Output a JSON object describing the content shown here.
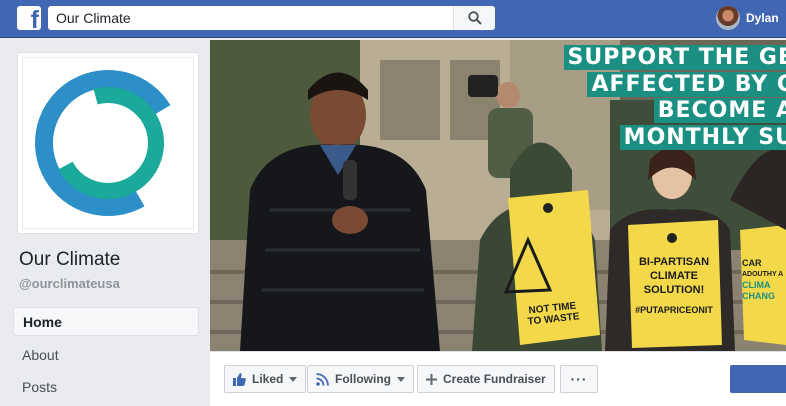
{
  "topbar": {
    "logo_letter": "f",
    "search_value": "Our Climate",
    "user_name": "Dylan"
  },
  "page": {
    "name": "Our Climate",
    "handle": "@ourclimateusa"
  },
  "nav": [
    {
      "label": "Home",
      "active": true
    },
    {
      "label": "About",
      "active": false
    },
    {
      "label": "Posts",
      "active": false
    }
  ],
  "cover": {
    "banner_lines": [
      "SUPPORT THE GE",
      "AFFECTED BY C",
      "BECOME A",
      "MONTHLY SU"
    ],
    "sign_left_line1": "NOT TIME",
    "sign_left_line2": "TO WASTE",
    "sign_mid_line1": "BI-PARTISAN",
    "sign_mid_line2": "CLIMATE",
    "sign_mid_line3": "SOLUTION!",
    "sign_mid_tag": "#PUTAPRICEONIT",
    "sign_right_line1": "CAR",
    "sign_right_line2": "ADOUTHY A",
    "sign_right_line3": "CLIMA",
    "sign_right_line4": "CHANG"
  },
  "actions": {
    "liked": "Liked",
    "following": "Following",
    "fundraiser": "Create Fundraiser",
    "more": "···"
  },
  "colors": {
    "facebook_blue": "#4267b2",
    "logo_teal": "#1aa99a",
    "logo_blue": "#2d8fc7",
    "banner_green": "#1b8f82",
    "sign_yellow": "#f3d84a"
  }
}
